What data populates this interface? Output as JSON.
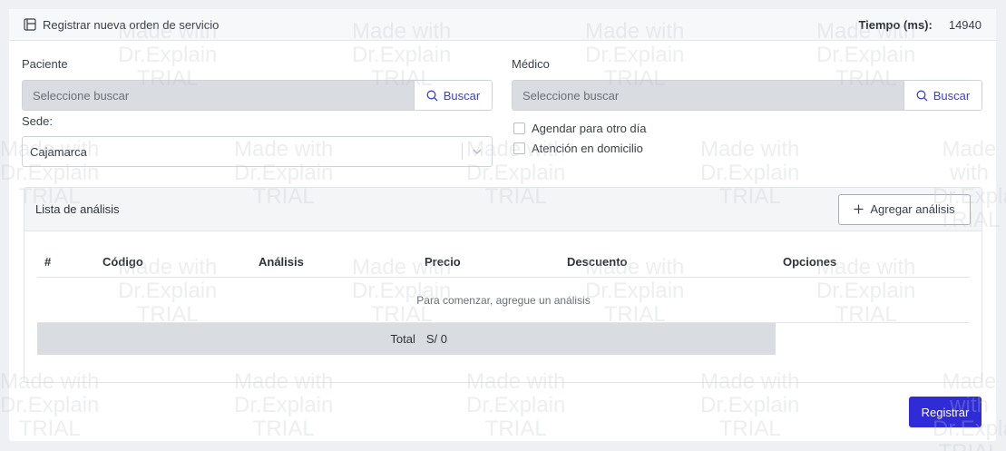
{
  "header": {
    "title": "Registrar nueva orden de servicio",
    "timer_label": "Tiempo (ms):",
    "timer_value": "14940"
  },
  "patient": {
    "label": "Paciente",
    "placeholder": "Seleccione buscar",
    "search_label": "Buscar"
  },
  "doctor": {
    "label": "Médico",
    "placeholder": "Seleccione buscar",
    "search_label": "Buscar"
  },
  "site": {
    "label": "Sede:",
    "value": "Cajamarca"
  },
  "options": {
    "schedule_other_day": "Agendar para otro día",
    "home_care": "Atención en domicilio"
  },
  "analysis": {
    "title": "Lista de análisis",
    "add_button": "Agregar análisis",
    "columns": [
      "#",
      "Código",
      "Análisis",
      "Precio",
      "Descuento",
      "Opciones"
    ],
    "empty_message": "Para comenzar, agregue un análisis",
    "total_label": "Total",
    "total_value": "S/ 0"
  },
  "actions": {
    "submit": "Registrar"
  },
  "watermark": {
    "line1": "Made with",
    "line2": "Dr.Explain",
    "line3": "TRIAL"
  },
  "colors": {
    "primary": "#2f2bd6",
    "link": "#3b3fd8",
    "disabled_input": "#d9dce1",
    "page_bg": "#eef0f3"
  }
}
